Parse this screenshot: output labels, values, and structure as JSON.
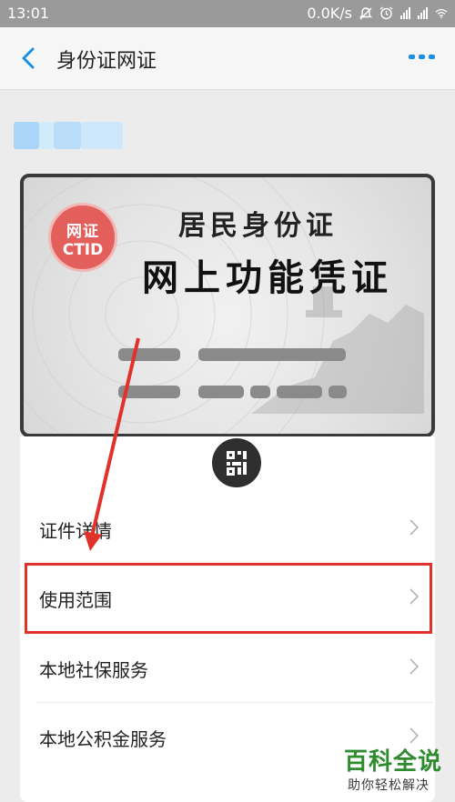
{
  "status_bar": {
    "time": "13:01",
    "net_speed": "0.0K/s"
  },
  "nav": {
    "title": "身份证网证"
  },
  "card": {
    "seal_line1": "网证",
    "seal_line2": "CTID",
    "title_line1": "居民身份证",
    "title_line2": "网上功能凭证"
  },
  "menu": {
    "items": [
      {
        "label": "证件详情"
      },
      {
        "label": "使用范围"
      },
      {
        "label": "本地社保服务"
      },
      {
        "label": "本地公积金服务"
      }
    ]
  },
  "watermark": {
    "brand": "百科全说",
    "slogan": "助你轻松解决"
  },
  "colors": {
    "accent": "#1a8fe6",
    "highlight": "#e0312a",
    "seal": "#e35f5b",
    "brand_green": "#2e8b2e"
  },
  "icons": [
    "signal-icon",
    "wifi-icon",
    "alarm-icon",
    "mute-icon",
    "back-arrow-icon",
    "more-icon",
    "qr-code-icon",
    "chevron-right-icon"
  ]
}
